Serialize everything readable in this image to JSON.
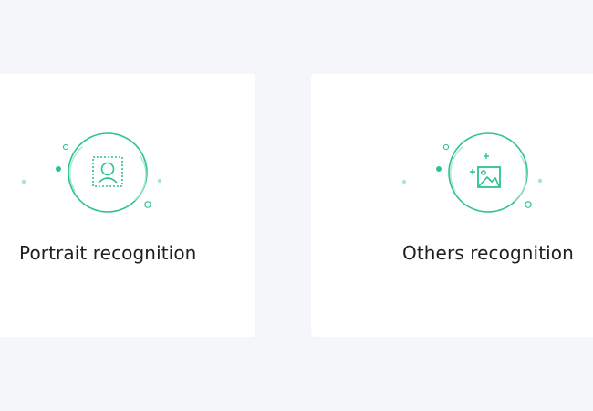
{
  "cards": [
    {
      "title": "Portrait recognition",
      "icon": "portrait-recognition-icon"
    },
    {
      "title": "Others recognition",
      "icon": "image-recognition-icon"
    }
  ],
  "colors": {
    "background": "#f5f6f9",
    "card": "#ffffff",
    "accent": "#2bc38e",
    "accent_light": "#a8e6cf",
    "text": "#1f1f1f"
  }
}
